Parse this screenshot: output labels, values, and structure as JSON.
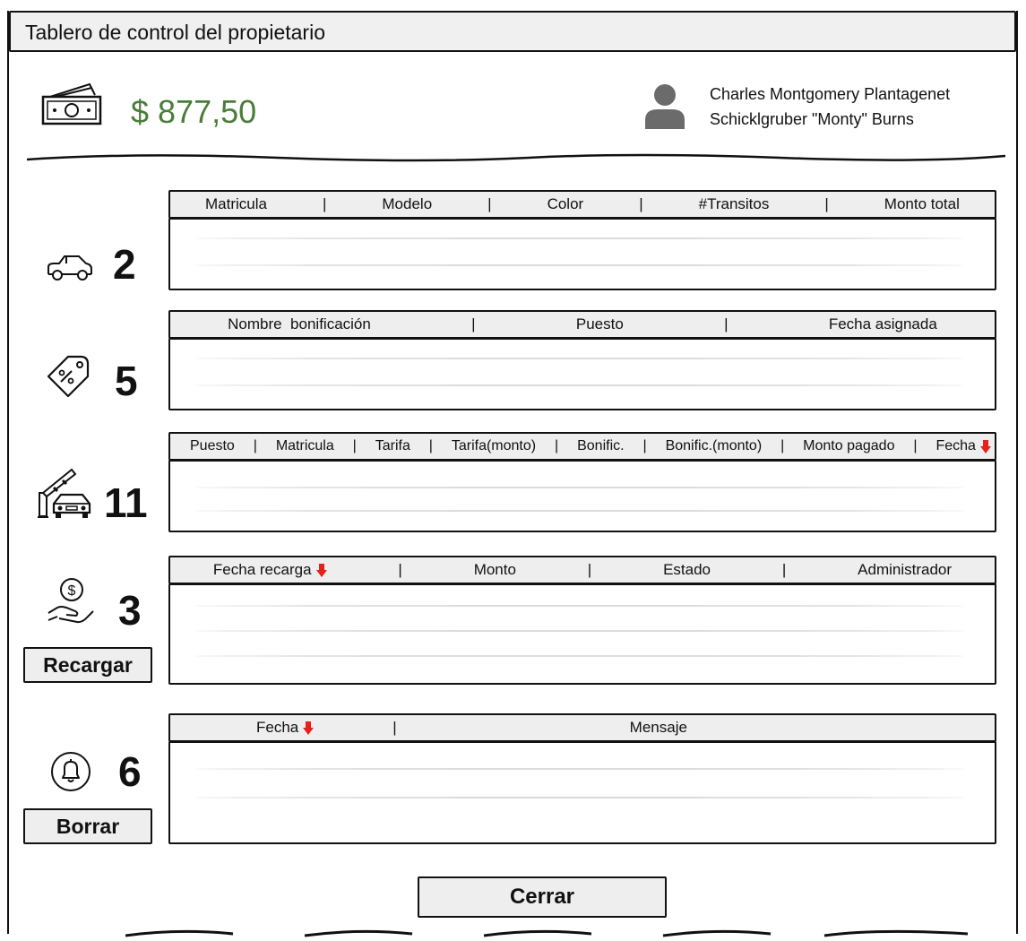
{
  "window": {
    "title": "Tablero de control del propietario"
  },
  "account": {
    "balance": "$ 877,50"
  },
  "user": {
    "name_line1": "Charles Montgomery Plantagenet",
    "name_line2": "Schicklgruber \"Monty\" Burns"
  },
  "vehicles": {
    "icon": "car-icon",
    "count": "2",
    "columns": [
      "Matricula",
      "Modelo",
      "Color",
      "#Transitos",
      "Monto total"
    ]
  },
  "bonuses": {
    "icon": "discount-tag-icon",
    "count": "5",
    "columns": [
      "Nombre  bonificación",
      "Puesto",
      "Fecha asignada"
    ]
  },
  "transits": {
    "icon": "toll-barrier-car-icon",
    "count": "11",
    "columns": [
      "Puesto",
      "Matricula",
      "Tarifa",
      "Tarifa(monto)",
      "Bonific.",
      "Bonific.(monto)",
      "Monto pagado",
      "Fecha"
    ]
  },
  "recharges": {
    "icon": "hand-dollar-icon",
    "count": "3",
    "columns": [
      "Fecha recarga",
      "Monto",
      "Estado",
      "Administrador"
    ],
    "button_label": "Recargar"
  },
  "notifications": {
    "icon": "bell-icon",
    "count": "6",
    "columns": [
      "Fecha",
      "Mensaje"
    ],
    "button_label": "Borrar"
  },
  "footer": {
    "close_label": "Cerrar"
  },
  "colors": {
    "balance": "#4a7d3a",
    "sort_arrow": "#e8201a",
    "header_bg": "#eeeeee"
  }
}
